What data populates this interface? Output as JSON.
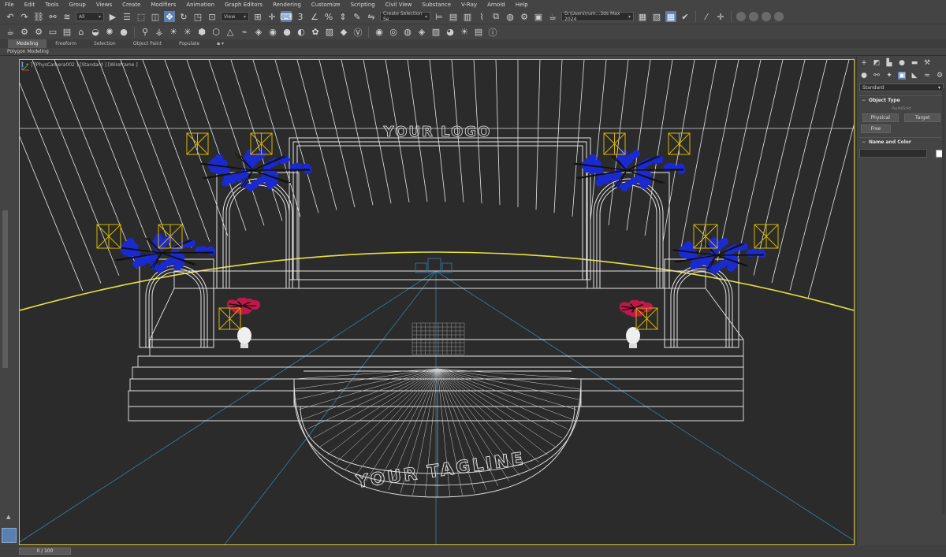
{
  "menubar": {
    "items": [
      "File",
      "Edit",
      "Tools",
      "Group",
      "Views",
      "Create",
      "Modifiers",
      "Animation",
      "Graph Editors",
      "Rendering",
      "Customize",
      "Scripting",
      "Civil View",
      "Substance",
      "V-Ray",
      "Arnold",
      "Help"
    ]
  },
  "toolbar": {
    "selection_filter": "All",
    "reference_coord": "View",
    "named_selection_placeholder": "Create Selection Se",
    "project_path": "D:\\Users\\rum...3ds Max 2024"
  },
  "ribbon": {
    "tabs": [
      "Modeling",
      "Freeform",
      "Selection",
      "Object Paint",
      "Populate"
    ],
    "active_tab": "Modeling",
    "sub_label": "Polygon Modeling"
  },
  "viewport": {
    "label": "[ + ] [PhysCamera002 ] [Standard ] [Wireframe ]",
    "logo_text": "YOUR LOGO",
    "tagline_text": "YOUR TAGLINE",
    "colors": {
      "border_active": "#d8c640",
      "background": "#2b2b2b",
      "wireframe": "#e6e6e6",
      "light_gizmo": "#d6b400",
      "flowers_blue": "#1a2ad0",
      "flowers_red": "#c0184a",
      "floor_guide": "#3a7fa6",
      "selection_curve": "#e8e040"
    }
  },
  "command_panel": {
    "category": "Standard",
    "object_type_header": "Object Type",
    "autogrid_label": "AutoGrid",
    "buttons": {
      "physical": "Physical",
      "target": "Target",
      "free": "Free"
    },
    "name_color_header": "Name and Color",
    "swatch_color": "#ffffff"
  },
  "timeline": {
    "frame_label": "0 / 100"
  }
}
